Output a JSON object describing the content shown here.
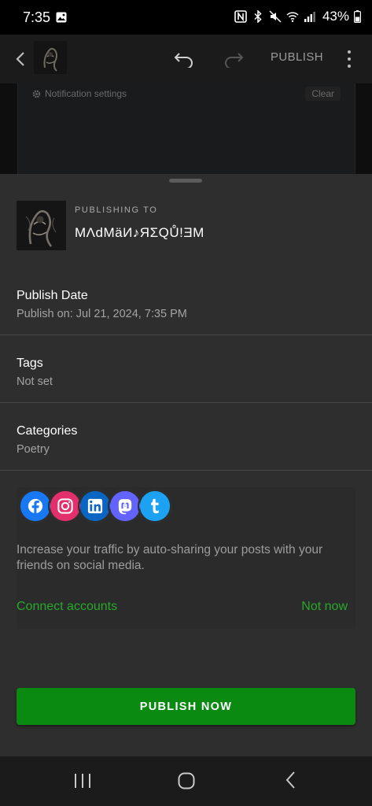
{
  "status": {
    "time": "7:35",
    "battery": "43%",
    "icons": [
      "image-icon",
      "nfc-icon",
      "bluetooth-icon",
      "mute-icon",
      "wifi-icon",
      "signal-icon",
      "battery-icon"
    ]
  },
  "toolbar": {
    "publish_label": "PUBLISH"
  },
  "editor": {
    "notification_settings": "Notification settings",
    "clear_label": "Clear"
  },
  "sheet": {
    "publishing_to_label": "PUBLISHING TO",
    "site_name": "MΛdMäИ♪ЯΣQŮ!ƎM",
    "rows": [
      {
        "label": "Publish Date",
        "value": "Publish on: Jul 21, 2024, 7:35 PM"
      },
      {
        "label": "Tags",
        "value": "Not set"
      },
      {
        "label": "Categories",
        "value": "Poetry"
      }
    ],
    "social": {
      "networks": [
        {
          "name": "facebook-icon",
          "color": "#1877f2",
          "glyph": "f"
        },
        {
          "name": "instagram-icon",
          "color": "#e1306c",
          "glyph": "◎"
        },
        {
          "name": "linkedin-icon",
          "color": "#0a66c2",
          "glyph": "in"
        },
        {
          "name": "mastodon-icon",
          "color": "#6364ff",
          "glyph": "m"
        },
        {
          "name": "tumblr-icon",
          "color": "#1da1f2",
          "glyph": "t"
        }
      ],
      "description": "Increase your traffic by auto-sharing your posts with your friends on social media.",
      "connect_label": "Connect accounts",
      "not_now_label": "Not now"
    },
    "publish_now_label": "PUBLISH NOW"
  },
  "colors": {
    "accent_green": "#27a92a",
    "button_green": "#0b8a12",
    "sheet_bg": "#2e2e2e"
  }
}
